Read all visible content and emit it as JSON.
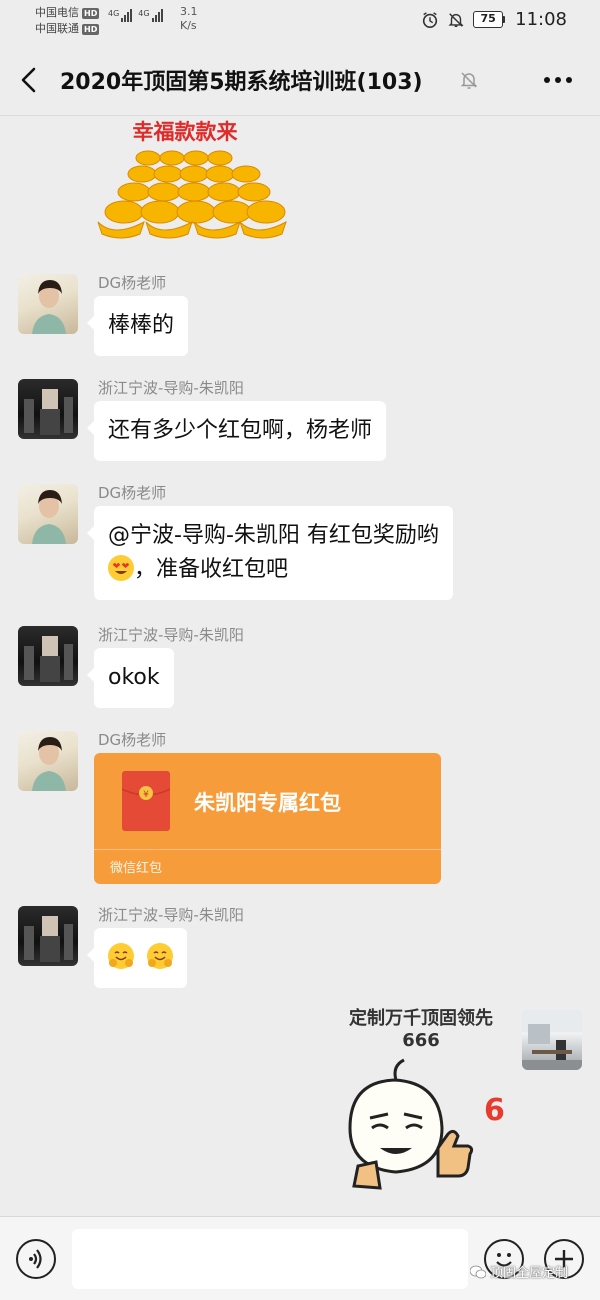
{
  "status_bar": {
    "carrier_1": "中国电信",
    "carrier_2": "中国联通",
    "hd_1": "HD",
    "hd_2": "HD",
    "network_1": "4G",
    "network_2": "4G",
    "speed_value": "3.1",
    "speed_unit": "K/s",
    "battery": "75",
    "time": "11:08"
  },
  "header": {
    "title": "2020年顶固第5期系统培训班(103)",
    "back_icon": "chevron-left-icon",
    "mute_icon": "bell-off-icon",
    "more_icon": "more-dots-icon"
  },
  "stickers": {
    "gold_caption": "幸福款款来",
    "self_caption_line1": "定制万千顶固领先",
    "self_caption_line2": "666",
    "self_badge": "6"
  },
  "messages": [
    {
      "sender": "DG杨老师",
      "text": "棒棒的"
    },
    {
      "sender": "浙江宁波-导购-朱凯阳",
      "text": "还有多少个红包啊，杨老师"
    },
    {
      "sender": "DG杨老师",
      "text_line1": "@宁波-导购-朱凯阳  有红包奖励哟",
      "text_line2": "，准备收红包吧"
    },
    {
      "sender": "浙江宁波-导购-朱凯阳",
      "text": "okok"
    },
    {
      "sender": "DG杨老师",
      "redpacket_title": "朱凯阳专属红包",
      "redpacket_label": "微信红包",
      "redpacket_symbol": "¥"
    },
    {
      "sender": "浙江宁波-导购-朱凯阳"
    }
  ],
  "input_bar": {
    "voice_icon": "voice-icon",
    "emoji_icon": "emoji-icon",
    "plus_icon": "plus-icon",
    "watermark": "顶固全屋定制"
  },
  "colors": {
    "background": "#ededed",
    "redpacket": "#f79c3b",
    "sticker_red": "#e02b2b"
  }
}
